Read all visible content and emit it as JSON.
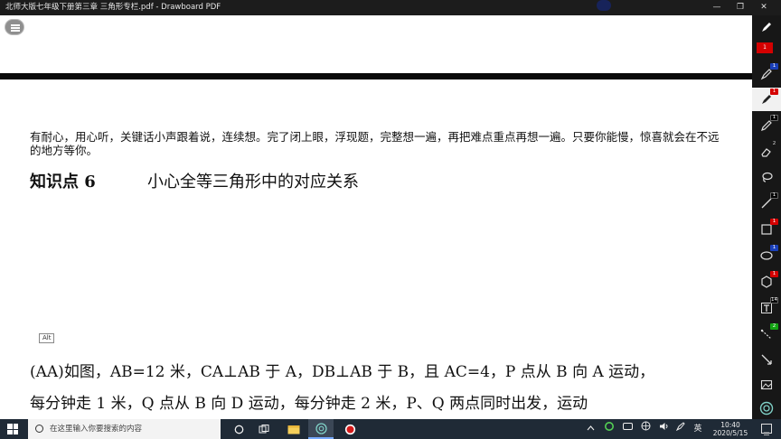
{
  "window": {
    "title": "北师大版七年级下册第三章   三角形专栏.pdf - Drawboard PDF",
    "minimize_label": "—",
    "restore_label": "❐",
    "close_label": "✕"
  },
  "document": {
    "paragraph": "有耐心，用心听，关键话小声跟着说，连续想。完了闭上眼，浮现题，完整想一遍，再把难点重点再想一遍。只要你能慢，惊喜就会在不远的地方等你。",
    "heading": "知识点 6",
    "subheading": "小心全等三角形中的对应关系",
    "alt_badge": "Alt",
    "problem_line1": "(AA)如图，AB=12 米，CA⊥AB 于 A，DB⊥AB 于 B，且 AC=4，P 点从 B 向 A 运动，",
    "problem_line2": "每分钟走 1 米，Q 点从 B 向 D 运动，每分钟走 2 米，P、Q 两点同时出发，运动"
  },
  "toolbar": {
    "tools": [
      {
        "name": "pen-tool",
        "badge": "1",
        "badge_color": "red"
      },
      {
        "name": "pen-tool-blue",
        "badge": "1",
        "badge_color": "blue"
      },
      {
        "name": "pen-tool-red-active",
        "badge": "1",
        "badge_color": "red"
      },
      {
        "name": "pencil-tool",
        "badge": "1",
        "badge_color": "black"
      },
      {
        "name": "eraser-tool",
        "badge": "2",
        "badge_color": "none"
      },
      {
        "name": "lasso-tool",
        "badge": "",
        "badge_color": "none"
      },
      {
        "name": "line-tool",
        "badge": "1",
        "badge_color": "black"
      },
      {
        "name": "rectangle-tool",
        "badge": "1",
        "badge_color": "red"
      },
      {
        "name": "ellipse-tool",
        "badge": "1",
        "badge_color": "blue"
      },
      {
        "name": "polygon-tool",
        "badge": "1",
        "badge_color": "red"
      },
      {
        "name": "text-tool",
        "badge": "14",
        "badge_color": "black"
      },
      {
        "name": "measure-tool",
        "badge": "2",
        "badge_color": "green"
      },
      {
        "name": "move-tool",
        "badge": "",
        "badge_color": "none"
      },
      {
        "name": "image-tool",
        "badge": "",
        "badge_color": "none"
      },
      {
        "name": "settings-tool",
        "badge": "",
        "badge_color": "none"
      }
    ],
    "swatch_label": "1"
  },
  "taskbar": {
    "search_placeholder": "在这里输入你要搜索的内容",
    "ime_label": "英",
    "time": "10:40",
    "date": "2020/5/15"
  }
}
